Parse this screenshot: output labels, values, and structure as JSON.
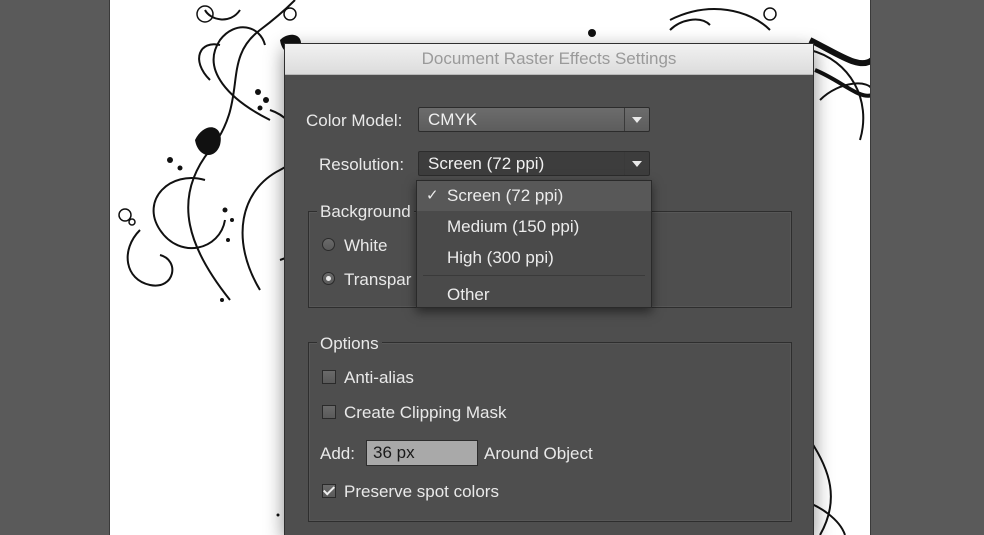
{
  "dialog": {
    "title": "Document Raster Effects Settings",
    "color_model": {
      "label": "Color Model:",
      "value": "CMYK"
    },
    "resolution": {
      "label": "Resolution:",
      "value": "Screen (72 ppi)",
      "options": [
        {
          "label": "Screen (72 ppi)",
          "selected": true
        },
        {
          "label": "Medium (150 ppi)",
          "selected": false
        },
        {
          "label": "High (300 ppi)",
          "selected": false
        },
        {
          "label": "Other",
          "selected": false
        }
      ],
      "check_glyph": "✓"
    },
    "background": {
      "title": "Background",
      "options": [
        {
          "label": "White",
          "selected": false
        },
        {
          "label": "Transpar",
          "selected": true
        }
      ]
    },
    "options": {
      "title": "Options",
      "anti_alias": {
        "label": "Anti-alias",
        "checked": false
      },
      "clipping_mask": {
        "label": "Create Clipping Mask",
        "checked": false
      },
      "add": {
        "label": "Add:",
        "value": "36 px",
        "suffix": "Around Object"
      },
      "preserve_spot": {
        "label": "Preserve spot colors",
        "checked": true
      }
    }
  },
  "colors": {
    "canvas_bg": "#5a5a5a",
    "dialog_bg": "#4e4e4e",
    "text": "#e9e9e9"
  }
}
